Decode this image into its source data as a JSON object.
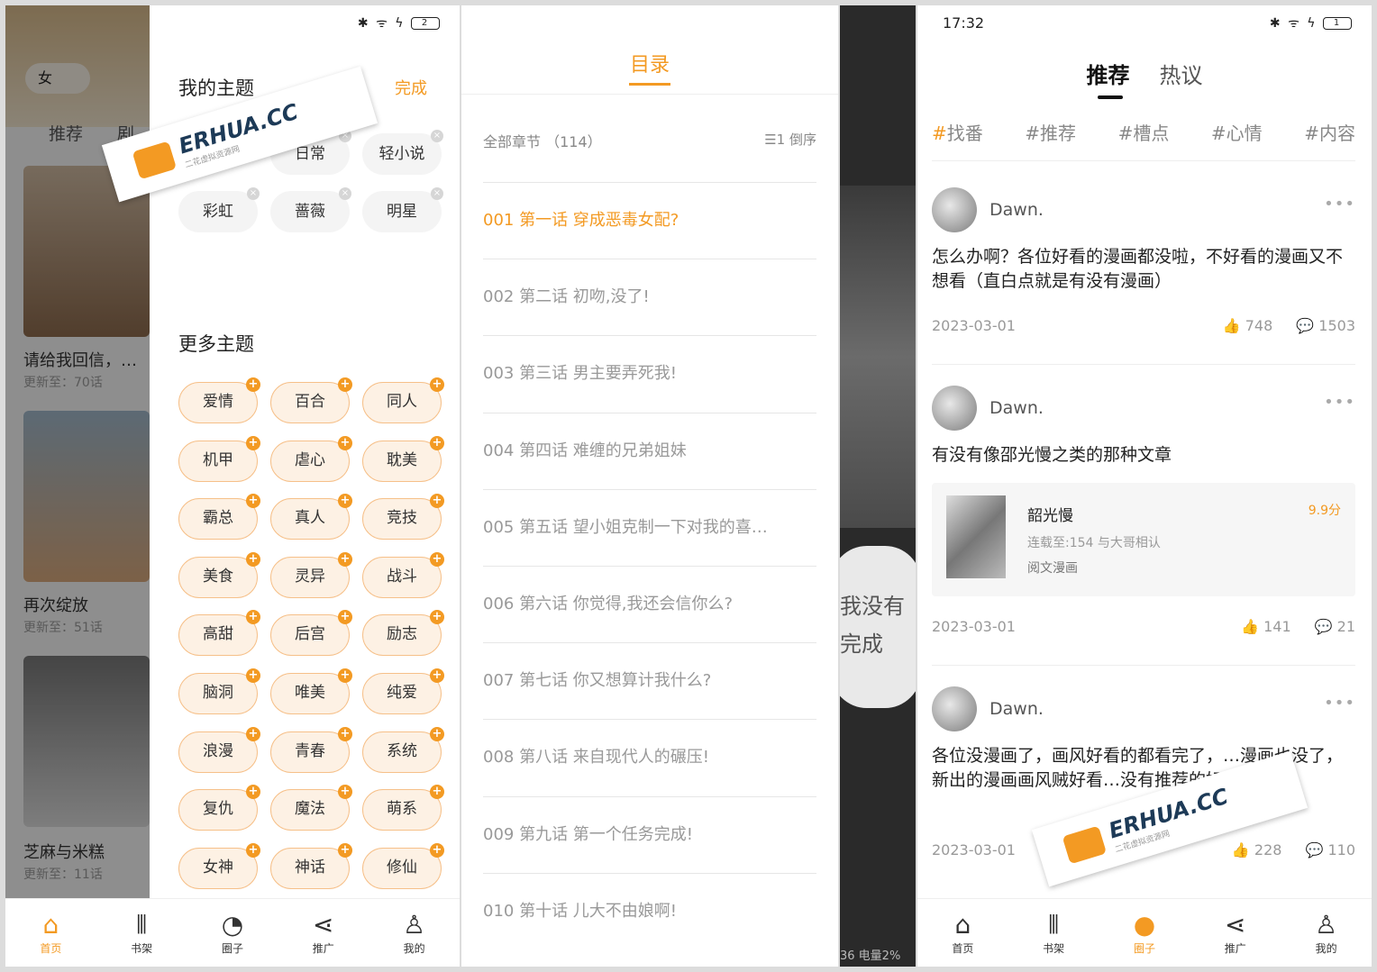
{
  "panel1": {
    "bg": {
      "toggle": "女",
      "tab1": "推荐",
      "tab2": "剧情",
      "books": [
        {
          "title": "请给我回信，…",
          "sub": "更新至：70话"
        },
        {
          "title": "再次绽放",
          "sub": "更新至：51话"
        },
        {
          "title": "芝麻与米糕",
          "sub": "更新至：11话"
        }
      ]
    },
    "status": "✱ ᯤ ϟ",
    "battery": "2",
    "my_title": "我的主题",
    "done": "完成",
    "my_chips": [
      "日常",
      "轻小说",
      "彩虹",
      "蔷薇",
      "明星"
    ],
    "more_title": "更多主题",
    "more_chips": [
      "爱情",
      "百合",
      "同人",
      "机甲",
      "虐心",
      "耽美",
      "霸总",
      "真人",
      "竞技",
      "美食",
      "灵异",
      "战斗",
      "高甜",
      "后宫",
      "励志",
      "脑洞",
      "唯美",
      "纯爱",
      "浪漫",
      "青春",
      "系统",
      "复仇",
      "魔法",
      "萌系",
      "女神",
      "神话",
      "修仙"
    ],
    "tabs": [
      {
        "icon": "⌂",
        "label": "首页"
      },
      {
        "icon": "⫴",
        "label": "书架"
      },
      {
        "icon": "◔",
        "label": "圈子"
      },
      {
        "icon": "⋖",
        "label": "推广"
      },
      {
        "icon": "♙",
        "label": "我的"
      }
    ]
  },
  "panel2": {
    "title": "目录",
    "all": "全部章节 （114）",
    "sort": "☰1 倒序",
    "chapters": [
      "001 第一话 穿成恶毒女配?",
      "002 第二话 初吻,没了!",
      "003 第三话 男主要弄死我!",
      "004 第四话 难缠的兄弟姐妹",
      "005 第五话 望小姐克制一下对我的喜…",
      "006 第六话 你觉得,我还会信你么?",
      "007 第七话 你又想算计我什么?",
      "008 第八话 来自现代人的碾压!",
      "009 第九话 第一个任务完成!",
      "010 第十话 儿大不由娘啊!"
    ]
  },
  "panel3": {
    "bubble_line1": "我没有",
    "bubble_line2": "完成",
    "footer": "36 电量2%"
  },
  "panel4": {
    "time": "17:32",
    "battery": "1",
    "tab_on": "推荐",
    "tab_off": "热议",
    "hashtags": [
      "找番",
      "#推荐",
      "#槽点",
      "#心情",
      "#内容"
    ],
    "posts": [
      {
        "user": "Dawn.",
        "text": "怎么办啊？各位好看的漫画都没啦，不好看的漫画又不想看（直白点就是有没有漫画）",
        "date": "2023-03-01",
        "likes": "748",
        "comments": "1503"
      },
      {
        "user": "Dawn.",
        "text": "有没有像邵光慢之类的那种文章",
        "date": "2023-03-01",
        "likes": "141",
        "comments": "21"
      },
      {
        "user": "Dawn.",
        "text": "各位没漫画了，画风好看的都看完了，…漫画也没了，新出的漫画画风贼好看…没有推荐的好看画风…",
        "date": "2023-03-01",
        "likes": "228",
        "comments": "110"
      }
    ],
    "card": {
      "title": "韶光慢",
      "sub": "连载至:154 与大哥相认",
      "publisher": "阅文漫画",
      "score": "9.9分"
    },
    "tabs": [
      {
        "icon": "⌂",
        "label": "首页"
      },
      {
        "icon": "⫴",
        "label": "书架"
      },
      {
        "icon": "●",
        "label": "圈子"
      },
      {
        "icon": "⋖",
        "label": "推广"
      },
      {
        "icon": "♙",
        "label": "我的"
      }
    ]
  },
  "watermark": {
    "brand": "ERHUA.CC",
    "sub": "二花虚拟资源网"
  },
  "colors": {
    "accent": "#f39a23"
  }
}
